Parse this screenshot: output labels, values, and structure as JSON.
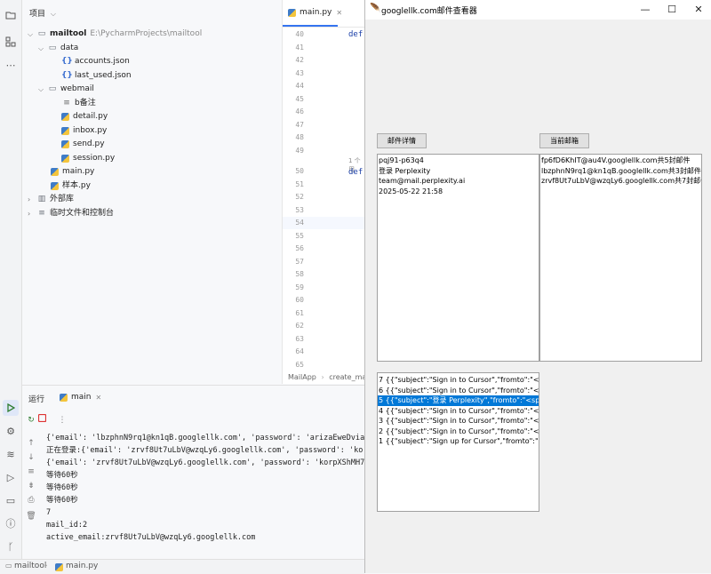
{
  "ide": {
    "project_header": "项目",
    "tree": [
      {
        "label": "mailtool",
        "path": "E:\\PycharmProjects\\mailtool",
        "kind": "folder-open",
        "level": 0
      },
      {
        "label": "data",
        "kind": "folder-open",
        "level": 1
      },
      {
        "label": "accounts.json",
        "kind": "json",
        "level": 2
      },
      {
        "label": "last_used.json",
        "kind": "json",
        "level": 2
      },
      {
        "label": "webmail",
        "kind": "folder-open",
        "level": 1
      },
      {
        "label": "b备注",
        "kind": "text",
        "level": 2
      },
      {
        "label": "detail.py",
        "kind": "py",
        "level": 2
      },
      {
        "label": "inbox.py",
        "kind": "py",
        "level": 2
      },
      {
        "label": "send.py",
        "kind": "py",
        "level": 2
      },
      {
        "label": "session.py",
        "kind": "py",
        "level": 2
      },
      {
        "label": "main.py",
        "kind": "py",
        "level": 1
      },
      {
        "label": "样本.py",
        "kind": "py",
        "level": 1
      },
      {
        "label": "外部库",
        "kind": "folder-closed",
        "level": 0
      },
      {
        "label": "临时文件和控制台",
        "kind": "folder-closed",
        "level": 0
      }
    ],
    "editor": {
      "tab_label": "main.py",
      "line_numbers": [
        "40",
        "41",
        "42",
        "43",
        "44",
        "45",
        "46",
        "47",
        "48",
        "49",
        "50",
        "51",
        "52",
        "53",
        "54",
        "55",
        "56",
        "57",
        "58",
        "59",
        "60",
        "61",
        "62",
        "63",
        "64",
        "65"
      ],
      "def_keyword": "def",
      "usage_hint": "1 个用",
      "breadcrumb": [
        "MailApp",
        "create_ma"
      ]
    },
    "run": {
      "tab_run": "运行",
      "tab_main": "main",
      "console_lines": [
        "{'email': 'lbzphnN9rq1@kn1qB.googlellk.com', 'password': 'arizaEweDvia",
        "正在登录:{'email': 'zrvf8Ut7uLbV@wzqLy6.googlellk.com', 'password': 'ko",
        "{'email': 'zrvf8Ut7uLbV@wzqLy6.googlellk.com', 'password': 'korpXShMH7",
        "等待60秒",
        "等待60秒",
        "等待60秒",
        "7",
        "mail_id:2",
        "active_email:zrvf8Ut7uLbV@wzqLy6.googlellk.com"
      ]
    },
    "status_bar": [
      "mailtool",
      "main.py"
    ]
  },
  "app": {
    "title": "googlellk.com邮件查看器",
    "window_buttons": {
      "minimize": "—",
      "maximize": "☐",
      "close": "✕"
    },
    "detail_button": "邮件详情",
    "current_mailbox_button": "当前邮箱",
    "detail_lines": [
      "pqj91-p63q4",
      "登录 Perplexity",
      "team@mail.perplexity.ai",
      "2025-05-22 21:58"
    ],
    "mailbox_lines": [
      "fp6fD6KhIT@au4V.googlellk.com共5封邮件",
      "lbzphnN9rq1@kn1qB.googlellk.com共3封邮件",
      "zrvf8Ut7uLbV@wzqLy6.googlellk.com共7封邮件"
    ],
    "mail_list": [
      {
        "text": "7 {{\"subject\":\"Sign in to Cursor\",\"fromto\":\"<span",
        "selected": false
      },
      {
        "text": "6 {{\"subject\":\"Sign in to Cursor\",\"fromto\":\"<span",
        "selected": false
      },
      {
        "text": "5 {{\"subject\":\"登录 Perplexity\",\"fromto\":\"<span cl",
        "selected": true
      },
      {
        "text": "4 {{\"subject\":\"Sign in to Cursor\",\"fromto\":\"<span",
        "selected": false
      },
      {
        "text": "3 {{\"subject\":\"Sign in to Cursor\",\"fromto\":\"<span",
        "selected": false
      },
      {
        "text": "2 {{\"subject\":\"Sign in to Cursor\",\"fromto\":\"<span",
        "selected": false
      },
      {
        "text": "1 {{\"subject\":\"Sign up for Cursor\",\"fromto\":\"<spa",
        "selected": false
      }
    ]
  }
}
